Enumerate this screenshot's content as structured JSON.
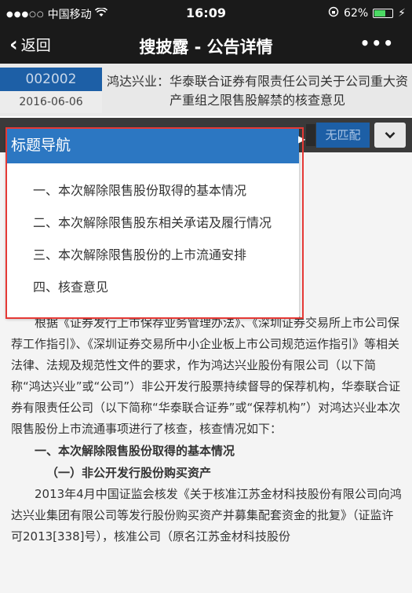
{
  "status_bar": {
    "signal": "●●●○○",
    "carrier": "中国移动",
    "wifi_icon": "wifi-icon",
    "time": "16:09",
    "battery_percent": "62%",
    "battery_level": 0.62
  },
  "nav": {
    "back_label": "返回",
    "title": "搜披露 - 公告详情",
    "more_label": "•••"
  },
  "header": {
    "stock_code": "002002",
    "date": "2016-06-06",
    "title": "鸿达兴业：华泰联合证券有限责任公司关于公司重大资产重组之限售股解禁的核查意见"
  },
  "search_bar": {
    "no_match_label": "无匹配",
    "dropdown_icon": "chevron-down-icon"
  },
  "title_nav": {
    "header": "标题导航",
    "items": [
      "一、本次解除限售股份取得的基本情况",
      "二、本次解除限售股东相关承诺及履行情况",
      "三、本次解除限售股份的上市流通安排",
      "四、核查意见"
    ]
  },
  "document": {
    "para1": "根据《证券发行上市保荐业务管理办法》、《深圳证券交易所上市公司保荐工作指引》、《深圳证券交易所中小企业板上市公司规范运作指引》等相关法律、法规及规范性文件的要求，作为鸿达兴业股份有限公司（以下简称“鸿达兴业”或“公司”）非公开发行股票持续督导的保荐机构，华泰联合证券有限责任公司（以下简称“华泰联合证券”或“保荐机构”）对鸿达兴业本次限售股份上市流通事项进行了核查，核查情况如下：",
    "heading1": "一、本次解除限售股份取得的基本情况",
    "heading2": "（一）非公开发行股份购买资产",
    "para2": "2013年4月中国证监会核发《关于核准江苏金材科技股份有限公司向鸿达兴业集团有限公司等发行股份购买资产并募集配套资金的批复》（证监许可2013[338]号），核准公司（原名江苏金材科技股份"
  }
}
